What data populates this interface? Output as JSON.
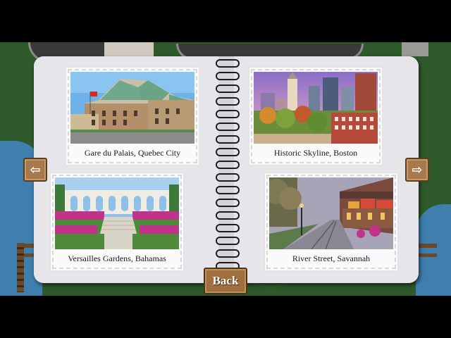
{
  "album": {
    "cards": [
      {
        "caption": "Gare du Palais, Quebec City"
      },
      {
        "caption": "Historic Skyline, Boston"
      },
      {
        "caption": "Versailles Gardens, Bahamas"
      },
      {
        "caption": "River Street, Savannah"
      }
    ]
  },
  "navigation": {
    "prev_icon": "left-arrow-icon",
    "prev_glyph": "⇦",
    "next_icon": "right-arrow-icon",
    "next_glyph": "⇨",
    "back_label": "Back"
  },
  "colors": {
    "page": "#e6e6ea",
    "button_wood": "#a06e3f",
    "grass": "#2e5a2b",
    "water": "#3f7fae"
  }
}
